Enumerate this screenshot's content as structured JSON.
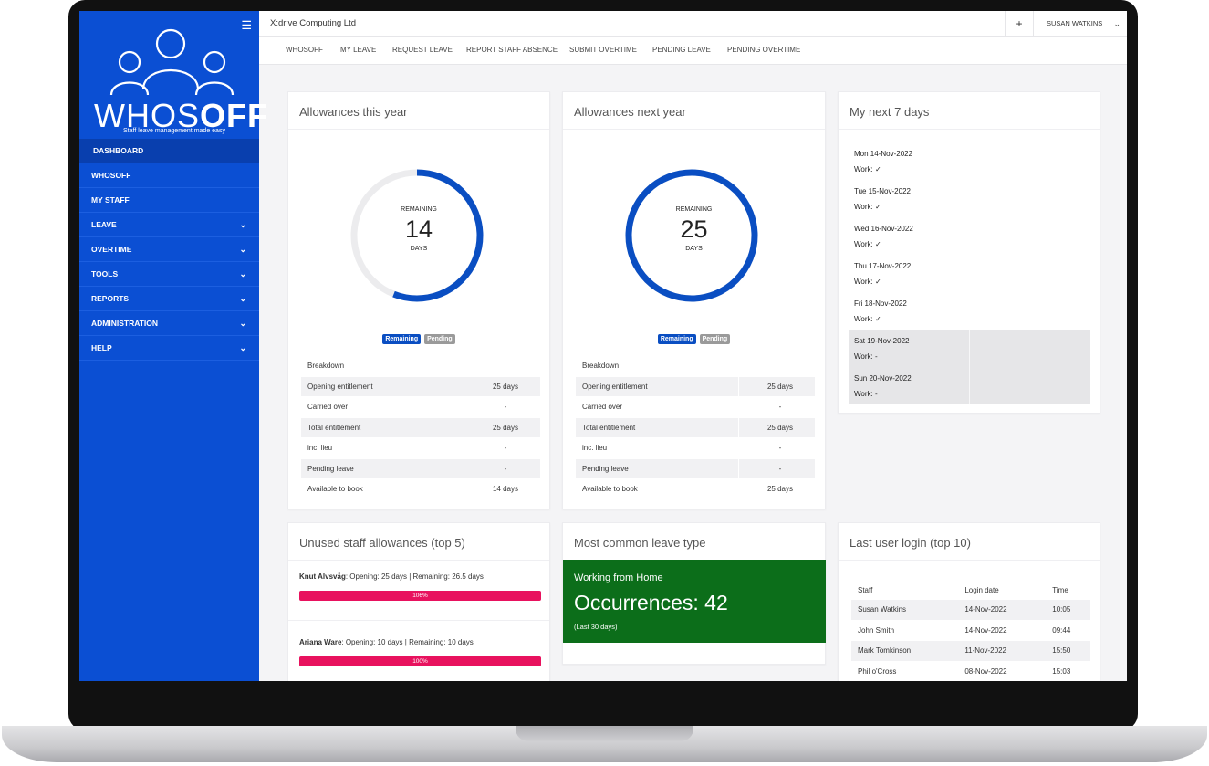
{
  "app": {
    "company": "X:drive Computing Ltd",
    "user": "SUSAN WATKINS",
    "plus_label": "+",
    "logo_word_light": "WHOS",
    "logo_word_bold": "OFF",
    "logo_tagline": "Staff leave management made easy",
    "menu_icon": "☰"
  },
  "sidebar": {
    "items": [
      {
        "label": "DASHBOARD",
        "has_chevron": false
      },
      {
        "label": "WHOSOFF",
        "has_chevron": false
      },
      {
        "label": "MY STAFF",
        "has_chevron": false
      },
      {
        "label": "LEAVE",
        "has_chevron": true
      },
      {
        "label": "OVERTIME",
        "has_chevron": true
      },
      {
        "label": "TOOLS",
        "has_chevron": true
      },
      {
        "label": "REPORTS",
        "has_chevron": true
      },
      {
        "label": "ADMINISTRATION",
        "has_chevron": true
      },
      {
        "label": "HELP",
        "has_chevron": true
      }
    ]
  },
  "tabs": [
    "WHOSOFF",
    "MY LEAVE",
    "REQUEST LEAVE",
    "REPORT STAFF ABSENCE",
    "SUBMIT OVERTIME",
    "PENDING LEAVE",
    "PENDING OVERTIME"
  ],
  "allowances_this_year": {
    "title": "Allowances this year",
    "remaining_label": "REMAINING",
    "value": "14",
    "unit": "DAYS",
    "fraction_remaining": 0.56,
    "badge_remaining": "Remaining",
    "badge_pending": "Pending",
    "breakdown_label": "Breakdown",
    "rows": [
      {
        "label": "Opening entitlement",
        "value": "25 days"
      },
      {
        "label": "Carried over",
        "value": "-"
      },
      {
        "label": "Total entitlement",
        "value": "25 days"
      },
      {
        "label": "inc. lieu",
        "value": "-"
      },
      {
        "label": "Pending leave",
        "value": "-"
      },
      {
        "label": "Available to book",
        "value": "14 days"
      }
    ]
  },
  "allowances_next_year": {
    "title": "Allowances next year",
    "remaining_label": "REMAINING",
    "value": "25",
    "unit": "DAYS",
    "fraction_remaining": 1.0,
    "badge_remaining": "Remaining",
    "badge_pending": "Pending",
    "breakdown_label": "Breakdown",
    "rows": [
      {
        "label": "Opening entitlement",
        "value": "25 days"
      },
      {
        "label": "Carried over",
        "value": "-"
      },
      {
        "label": "Total entitlement",
        "value": "25 days"
      },
      {
        "label": "inc. lieu",
        "value": "-"
      },
      {
        "label": "Pending leave",
        "value": "-"
      },
      {
        "label": "Available to book",
        "value": "25 days"
      }
    ]
  },
  "next_7_days": {
    "title": "My next 7 days",
    "days": [
      {
        "date": "Mon 14-Nov-2022",
        "work": "Work: ✓",
        "weekend": false
      },
      {
        "date": "Tue 15-Nov-2022",
        "work": "Work: ✓",
        "weekend": false
      },
      {
        "date": "Wed 16-Nov-2022",
        "work": "Work: ✓",
        "weekend": false
      },
      {
        "date": "Thu 17-Nov-2022",
        "work": "Work: ✓",
        "weekend": false
      },
      {
        "date": "Fri 18-Nov-2022",
        "work": "Work: ✓",
        "weekend": false
      },
      {
        "date": "Sat 19-Nov-2022",
        "work": "Work: -",
        "weekend": true
      },
      {
        "date": "Sun 20-Nov-2022",
        "work": "Work: -",
        "weekend": true
      }
    ]
  },
  "unused_allowances": {
    "title": "Unused staff allowances (top 5)",
    "items": [
      {
        "name": "Knut Alvsvåg",
        "detail": ": Opening: 25 days | Remaining: 26.5 days",
        "percent_label": "106%",
        "fraction": 1.0
      },
      {
        "name": "Ariana Ware",
        "detail": ": Opening: 10 days | Remaining: 10 days",
        "percent_label": "100%",
        "fraction": 1.0
      }
    ]
  },
  "common_leave": {
    "title": "Most common leave type",
    "leave_type": "Working from Home",
    "occurrences": "Occurrences: 42",
    "period": "(Last 30 days)"
  },
  "last_login": {
    "title": "Last user login (top 10)",
    "headers": [
      "Staff",
      "Login date",
      "Time"
    ],
    "rows": [
      [
        "Susan Watkins",
        "14-Nov-2022",
        "10:05"
      ],
      [
        "John Smith",
        "14-Nov-2022",
        "09:44"
      ],
      [
        "Mark Tomkinson",
        "11-Nov-2022",
        "15:50"
      ],
      [
        "Phil o'Cross",
        "08-Nov-2022",
        "15:03"
      ]
    ]
  },
  "colors": {
    "sidebar": "#0b4fd3",
    "donut_remaining": "#0a4ec2",
    "donut_track": "#ececee",
    "badge_remaining": "#0a4ec2",
    "badge_pending": "#9a9a9a",
    "progress_bar": "#e8125e",
    "leave_box": "#0c6e1a"
  }
}
